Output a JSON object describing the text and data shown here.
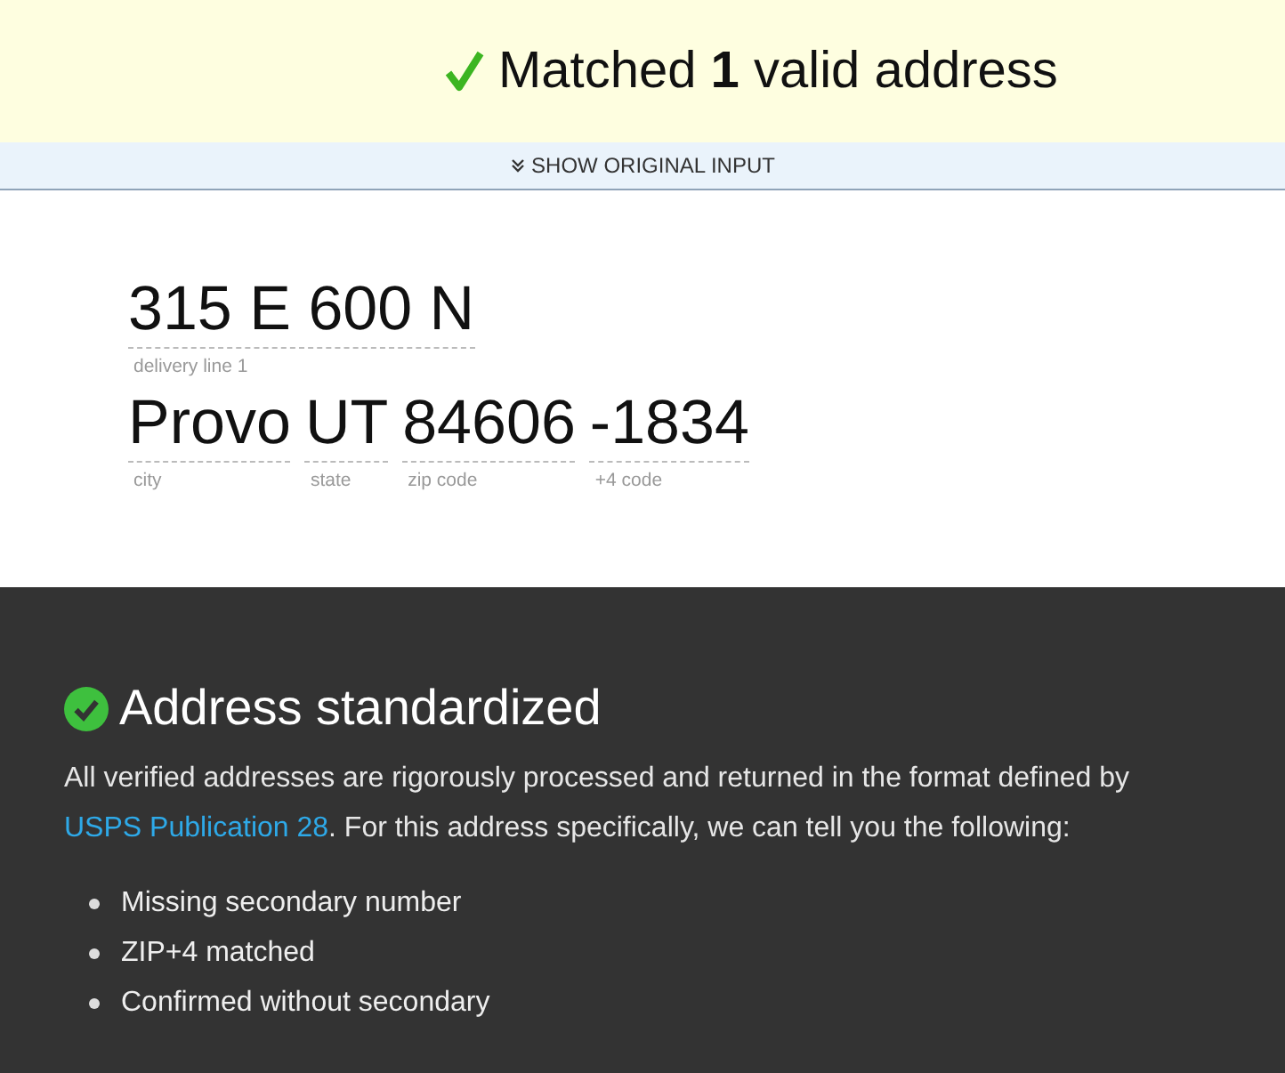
{
  "banner": {
    "headline": "Matched **1** valid address"
  },
  "toggle": {
    "label": "SHOW ORIGINAL INPUT",
    "expanded": false
  },
  "address": {
    "lines": [
      [
        {
          "value": "315 E 600 N",
          "label": "delivery line 1"
        }
      ],
      [
        {
          "value": "Provo",
          "label": "city"
        },
        {
          "value": "UT",
          "label": "state"
        },
        {
          "value": "84606",
          "label": "zip code"
        },
        {
          "value": "-1834",
          "label": "+4 code"
        }
      ]
    ]
  },
  "result": {
    "title": "Address standardized",
    "text_before": "All verified addresses are rigorously processed and returned in the format defined by ",
    "link": "USPS Publication 28",
    "text_after": ". For this address specifically, we can tell you the following:",
    "items": [
      "Missing secondary number",
      "ZIP+4 matched",
      "Confirmed without secondary"
    ]
  }
}
